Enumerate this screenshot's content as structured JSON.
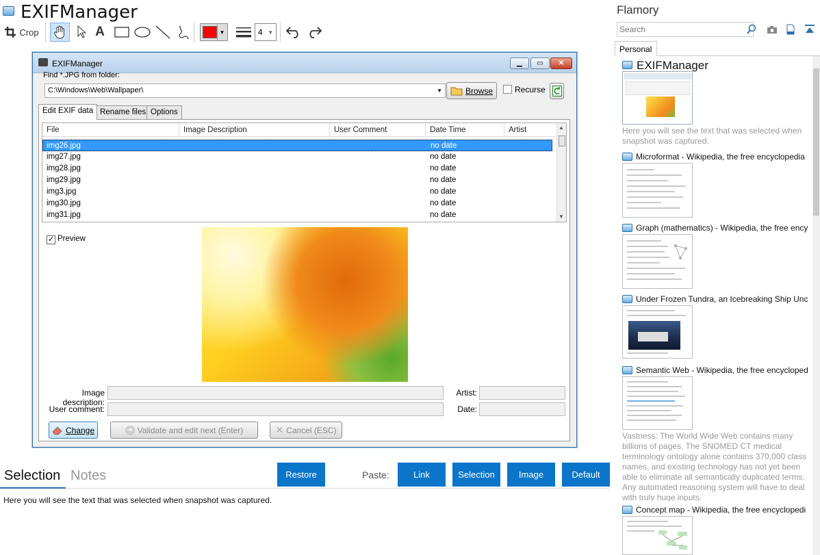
{
  "header": {
    "title": "EXIFManager"
  },
  "toolbar": {
    "crop_label": "Crop",
    "line_width": "4",
    "color": "#ff0000"
  },
  "dialog": {
    "title": "EXIFManager",
    "folder_label": "Find *.JPG from folder:",
    "folder_path": "C:\\Windows\\Web\\Wallpaper\\",
    "browse_label": "Browse",
    "recurse_label": "Recurse",
    "tabs": [
      "Edit EXIF data",
      "Rename files",
      "Options"
    ],
    "columns": [
      "File",
      "Image Description",
      "User Comment",
      "Date Time",
      "Artist"
    ],
    "rows": [
      {
        "file": "img26.jpg",
        "date": "no date"
      },
      {
        "file": "img27.jpg",
        "date": "no date"
      },
      {
        "file": "img28.jpg",
        "date": "no date"
      },
      {
        "file": "img29.jpg",
        "date": "no date"
      },
      {
        "file": "img3.jpg",
        "date": "no date"
      },
      {
        "file": "img30.jpg",
        "date": "no date"
      },
      {
        "file": "img31.jpg",
        "date": "no date"
      }
    ],
    "preview_label": "Preview",
    "image_description_label": "Image description:",
    "user_comment_label": "User comment:",
    "artist_label": "Artist:",
    "date_label": "Date:",
    "change_label": "Change",
    "validate_label": "Validate and edit next (Enter)",
    "cancel_label": "Cancel (ESC)"
  },
  "bottom": {
    "tab_selection": "Selection",
    "tab_notes": "Notes",
    "restore_label": "Restore",
    "paste_label": "Paste:",
    "link_label": "Link",
    "selection_label": "Selection",
    "image_label": "Image",
    "default_label": "Default",
    "selected_text": "Here you will see the text that was selected when snapshot was captured."
  },
  "sidebar": {
    "title": "Flamory",
    "search_placeholder": "Search",
    "tab_personal": "Personal",
    "items": [
      {
        "title": "EXIFManager",
        "note": "Here you will see the text that was selected when snapshot was captured."
      },
      {
        "title": "Microformat - Wikipedia, the free encyclopedia"
      },
      {
        "title": "Graph (mathematics) - Wikipedia, the free ency"
      },
      {
        "title": "Under Frozen Tundra, an Icebreaking Ship Unco"
      },
      {
        "title": "Semantic Web - Wikipedia, the free encycloped",
        "note": "Vastness: The World Wide Web contains many billions of pages. The SNOMED CT medical terminology ontology alone contains 370,000 class names, and existing technology has not yet been able to eliminate all semantically duplicated terms. Any automated reasoning system will have to deal with truly huge inputs."
      },
      {
        "title": "Concept map - Wikipedia, the free encyclopedi"
      }
    ]
  }
}
